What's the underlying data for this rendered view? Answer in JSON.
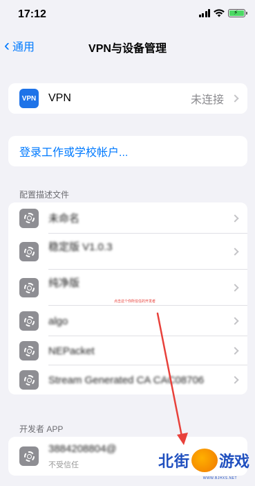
{
  "status_bar": {
    "time": "17:12"
  },
  "nav": {
    "back_label": "通用",
    "title": "VPN与设备管理"
  },
  "vpn": {
    "badge": "VPN",
    "label": "VPN",
    "status": "未连接"
  },
  "signin": {
    "label": "登录工作或学校帐户..."
  },
  "profiles_section": {
    "header": "配置描述文件",
    "items": [
      {
        "label": "未命名"
      },
      {
        "label": "稳定版 V1.0.3"
      },
      {
        "label": "纯净版"
      },
      {
        "label": "algo"
      },
      {
        "label": "NEPacket"
      },
      {
        "label": "Stream Generated CA CAC08706"
      }
    ]
  },
  "annotation": {
    "text": "点击这个你所信任的开发者"
  },
  "developer_section": {
    "header": "开发者 APP",
    "item": {
      "label": "3884208804@",
      "sub": "不受信任"
    }
  },
  "watermark": {
    "left": "北街",
    "right": "游戏",
    "url": "WWW.BJHXS.NET"
  },
  "colors": {
    "accent": "#007aff",
    "vpn_badge": "#1e73e8",
    "arrow": "#e8413b"
  }
}
